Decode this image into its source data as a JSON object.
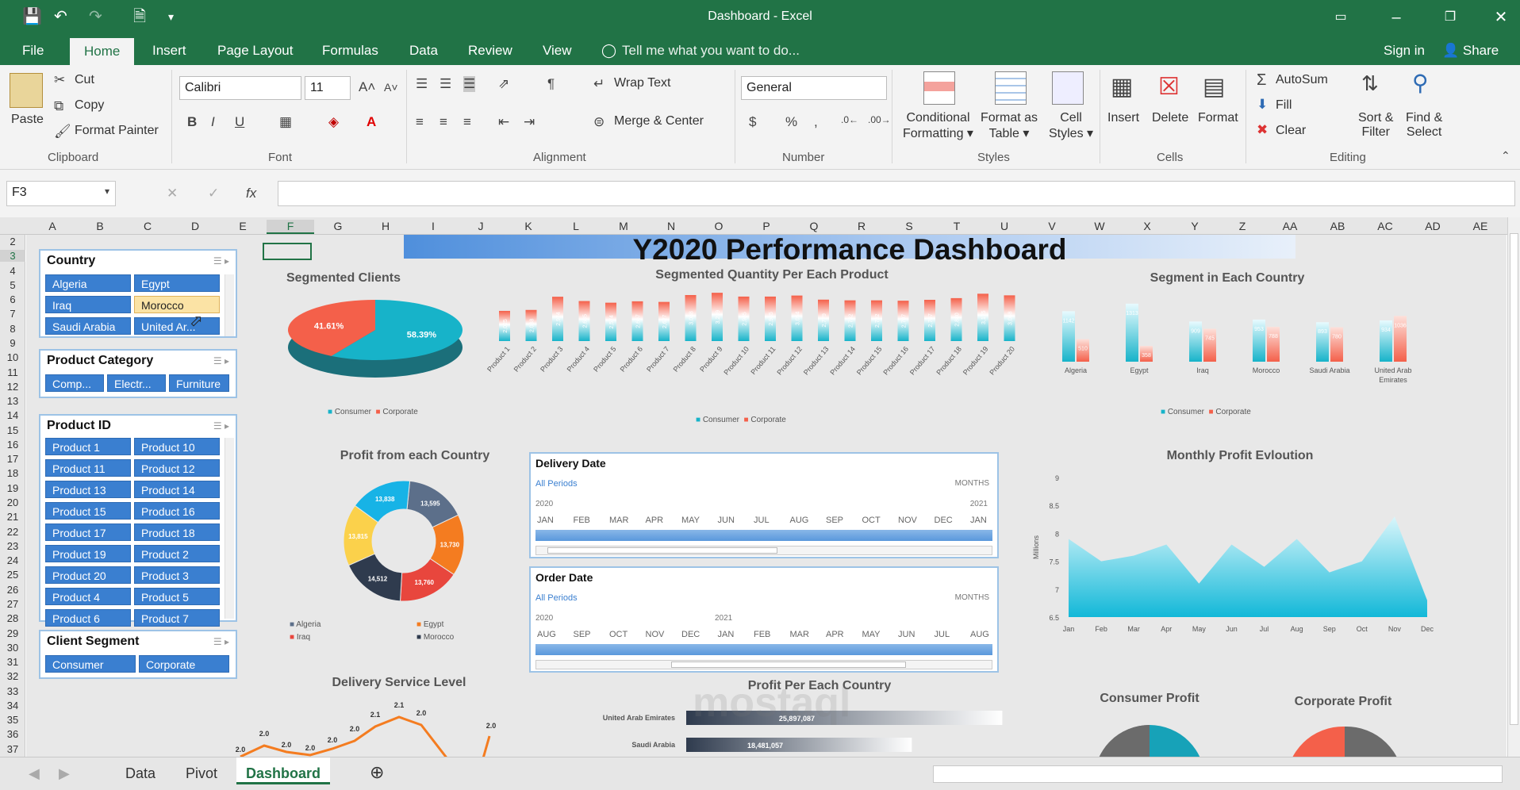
{
  "window": {
    "title": "Dashboard - Excel"
  },
  "ribbon_tabs": [
    "File",
    "Home",
    "Insert",
    "Page Layout",
    "Formulas",
    "Data",
    "Review",
    "View"
  ],
  "tell_me": "Tell me what you want to do...",
  "account": {
    "sign_in": "Sign in",
    "share": "Share"
  },
  "clipboard": {
    "paste": "Paste",
    "cut": "Cut",
    "copy": "Copy",
    "format_painter": "Format Painter",
    "group": "Clipboard"
  },
  "font": {
    "name": "Calibri",
    "size": "11",
    "group": "Font"
  },
  "alignment": {
    "wrap": "Wrap Text",
    "merge": "Merge & Center",
    "group": "Alignment"
  },
  "number": {
    "format": "General",
    "group": "Number"
  },
  "styles": {
    "conditional": [
      "Conditional",
      "Formatting"
    ],
    "format_table": [
      "Format as",
      "Table"
    ],
    "cell_styles": [
      "Cell",
      "Styles"
    ],
    "group": "Styles"
  },
  "cells": {
    "insert": "Insert",
    "delete": "Delete",
    "format": "Format",
    "group": "Cells"
  },
  "editing": {
    "autosum": "AutoSum",
    "fill": "Fill",
    "clear": "Clear",
    "sort": [
      "Sort &",
      "Filter"
    ],
    "find": [
      "Find &",
      "Select"
    ],
    "group": "Editing"
  },
  "formula_bar": {
    "name_box": "F3",
    "value": ""
  },
  "columns": [
    "A",
    "B",
    "C",
    "D",
    "E",
    "F",
    "G",
    "H",
    "I",
    "J",
    "K",
    "L",
    "M",
    "N",
    "O",
    "P",
    "Q",
    "R",
    "S",
    "T",
    "U",
    "V",
    "W",
    "X",
    "Y",
    "Z",
    "AA",
    "AB",
    "AC",
    "AD",
    "AE"
  ],
  "rows": [
    "2",
    "3",
    "4",
    "5",
    "6",
    "7",
    "8",
    "9",
    "10",
    "11",
    "12",
    "13",
    "14",
    "15",
    "16",
    "17",
    "18",
    "19",
    "20",
    "21",
    "22",
    "23",
    "24",
    "25",
    "26",
    "27",
    "28",
    "29",
    "30",
    "31",
    "32",
    "33",
    "34",
    "35",
    "36",
    "37"
  ],
  "dashboard_title": "Y2020 Performance Dashboard",
  "slicers": {
    "country": {
      "title": "Country",
      "items": [
        "Algeria",
        "Egypt",
        "Iraq",
        "Morocco",
        "Saudi Arabia",
        "United Ar..."
      ],
      "selected": "Morocco"
    },
    "category": {
      "title": "Product Category",
      "items": [
        "Comp...",
        "Electr...",
        "Furniture"
      ]
    },
    "product": {
      "title": "Product ID",
      "items": [
        "Product 1",
        "Product 10",
        "Product 11",
        "Product 12",
        "Product 13",
        "Product 14",
        "Product 15",
        "Product 16",
        "Product 17",
        "Product 18",
        "Product 19",
        "Product 2",
        "Product 20",
        "Product 3",
        "Product 4",
        "Product 5",
        "Product 6",
        "Product 7"
      ]
    },
    "segment": {
      "title": "Client Segment",
      "items": [
        "Consumer",
        "Corporate"
      ]
    }
  },
  "colors": {
    "excel_green": "#217346",
    "consumer": "#17b3c9",
    "corporate": "#f4604a",
    "slicer_blue": "#3a7fd0"
  },
  "chart_data": [
    {
      "type": "pie",
      "title": "Segmented Clients",
      "categories": [
        "Consumer",
        "Corporate"
      ],
      "values": [
        58.39,
        41.61
      ],
      "labels": [
        "58.39%",
        "41.61%"
      ]
    },
    {
      "type": "bar",
      "title": "Segmented Quantity Per Each Product",
      "categories": [
        "Product 1",
        "Product 2",
        "Product 3",
        "Product 4",
        "Product 5",
        "Product 6",
        "Product 7",
        "Product 8",
        "Product 9",
        "Product 10",
        "Product 11",
        "Product 12",
        "Product 13",
        "Product 14",
        "Product 15",
        "Product 16",
        "Product 17",
        "Product 18",
        "Product 19",
        "Product 20"
      ],
      "series": [
        {
          "name": "Consumer",
          "values": [
            2025,
            2088,
            2974,
            2685,
            2574,
            2667,
            2627,
            3088,
            3239,
            2985,
            2985,
            3054,
            2779,
            2732,
            2732,
            2707,
            2767,
            2880,
            3175,
            3068
          ]
        },
        {
          "name": "Corporate",
          "values": [
            2025,
            2088,
            2974,
            2685,
            2574,
            2667,
            2627,
            3088,
            3239,
            2985,
            2985,
            3054,
            2779,
            2732,
            2732,
            2707,
            2767,
            2880,
            3175,
            3068
          ]
        }
      ],
      "data_labels": [
        "2,025",
        "2,088",
        "2,974",
        "2,685",
        "2,574",
        "2,667",
        "2,627",
        "3,088",
        "3,239",
        "2,985",
        "2,985",
        "3,054",
        "2,779",
        "2,732",
        "2,732",
        "2,707",
        "2,767",
        "2,880",
        "3,175",
        "3,068"
      ]
    },
    {
      "type": "bar",
      "title": "Segment in Each Country",
      "categories": [
        "Algeria",
        "Egypt",
        "Iraq",
        "Morocco",
        "Saudi Arabia",
        "United Arab Emirates"
      ],
      "series": [
        {
          "name": "Consumer",
          "values": [
            1142,
            1313,
            909,
            953,
            893,
            934
          ]
        },
        {
          "name": "Corporate",
          "values": [
            510,
            358,
            745,
            788,
            780,
            1036
          ]
        }
      ]
    },
    {
      "type": "pie",
      "title": "Profit from each Country",
      "categories": [
        "Algeria",
        "Egypt",
        "Iraq",
        "Morocco",
        "Saudi Arabia",
        "United Arab Emirates"
      ],
      "values": [
        13595,
        13730,
        13760,
        14512,
        13815,
        13838
      ],
      "labels": [
        "13,595",
        "13,730",
        "13,760",
        "14,512",
        "13,815",
        "13,838"
      ],
      "legend": [
        "Algeria",
        "Egypt",
        "Iraq",
        "Morocco"
      ]
    },
    {
      "type": "area",
      "title": "Monthly Profit Evloution",
      "ylabel": "Millions",
      "categories": [
        "Jan",
        "Feb",
        "Mar",
        "Apr",
        "May",
        "Jun",
        "Jul",
        "Aug",
        "Sep",
        "Oct",
        "Nov",
        "Dec"
      ],
      "values": [
        7.9,
        7.5,
        7.6,
        7.8,
        7.1,
        7.8,
        7.4,
        7.9,
        7.3,
        7.5,
        8.3,
        6.8
      ],
      "yticks": [
        "6.5",
        "7",
        "7.5",
        "8",
        "8.5",
        "9"
      ],
      "ylim": [
        6.5,
        9
      ]
    },
    {
      "type": "line",
      "title": "Delivery Service Level",
      "labels": [
        "2.0",
        "2.0",
        "2.0",
        "2.0",
        "2.0",
        "2.0",
        "2.1",
        "2.1",
        "2.0",
        "2.0"
      ]
    },
    {
      "type": "bar",
      "title": "Profit Per Each Country",
      "categories": [
        "United Arab Emirates",
        "Saudi Arabia"
      ],
      "values": [
        25897087,
        18481057
      ],
      "labels": [
        "25,897,087",
        "18,481,057"
      ]
    },
    {
      "type": "pie",
      "title": "Consumer Profit"
    },
    {
      "type": "pie",
      "title": "Corporate Profit"
    }
  ],
  "legend": {
    "consumer": "Consumer",
    "corporate": "Corporate"
  },
  "timelines": {
    "delivery": {
      "title": "Delivery Date",
      "all": "All Periods",
      "unit": "MONTHS",
      "years": [
        "2020",
        "2021"
      ],
      "months": [
        "JAN",
        "FEB",
        "MAR",
        "APR",
        "MAY",
        "JUN",
        "JUL",
        "AUG",
        "SEP",
        "OCT",
        "NOV",
        "DEC",
        "JAN"
      ]
    },
    "order": {
      "title": "Order Date",
      "all": "All Periods",
      "unit": "MONTHS",
      "years": [
        "2020",
        "2021"
      ],
      "months": [
        "AUG",
        "SEP",
        "OCT",
        "NOV",
        "DEC",
        "JAN",
        "FEB",
        "MAR",
        "APR",
        "MAY",
        "JUN",
        "JUL",
        "AUG"
      ]
    }
  },
  "sheet_tabs": [
    "Data",
    "Pivot",
    "Dashboard"
  ],
  "active_sheet": "Dashboard"
}
